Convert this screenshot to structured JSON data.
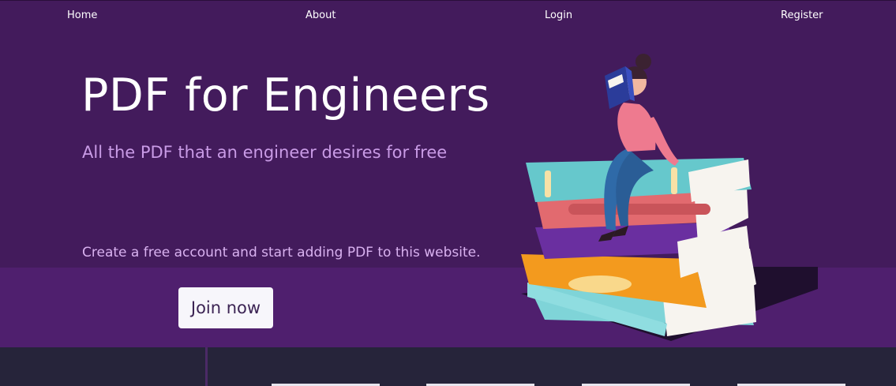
{
  "nav": {
    "home": "Home",
    "about": "About",
    "login": "Login",
    "register": "Register"
  },
  "hero": {
    "title": "PDF for Engineers",
    "subtitle": "All the PDF that an engineer desires for free",
    "cta_text": "Create a free account and start adding PDF to this website.",
    "join_button": "Join now",
    "illustration": "woman-reading-on-book-stack"
  },
  "colors": {
    "hero_top": "#431b5c",
    "hero_bottom": "#4f1f6e",
    "footer": "#26243a",
    "subtitle": "#c99be6"
  }
}
